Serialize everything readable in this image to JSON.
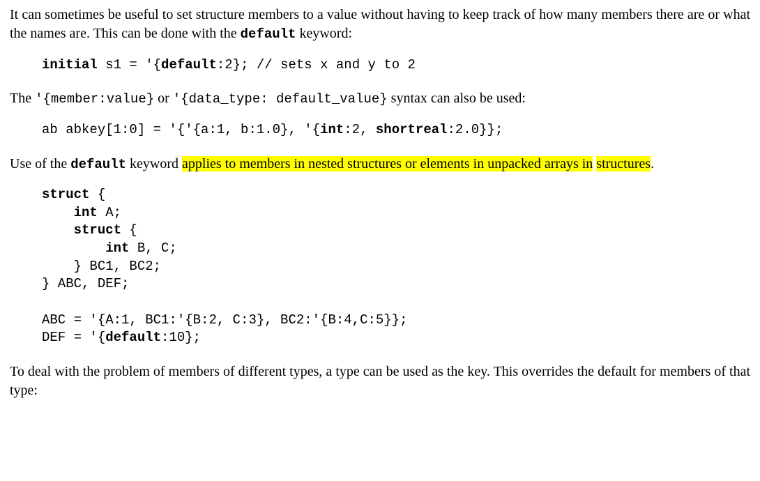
{
  "p1_a": "It can sometimes be useful to set structure members to a value without having to keep track of how many members there are or what the names are. This can be done with the ",
  "p1_kw": "default",
  "p1_b": " keyword:",
  "code1_a": "initial",
  "code1_b": " s1 = '{",
  "code1_c": "default",
  "code1_d": ":2}; // sets x and y to 2",
  "p2_a": "The ",
  "p2_m1": "'{member:value}",
  "p2_b": " or ",
  "p2_m2": "'{data_type: default_value}",
  "p2_c": " syntax can also be used:",
  "code2_a": "ab abkey[1:0] = '{'{a:1, b:1.0}, '{",
  "code2_b": "int",
  "code2_c": ":2, ",
  "code2_d": "shortreal",
  "code2_e": ":2.0}};",
  "p3_a": "Use of the ",
  "p3_kw": "default",
  "p3_b": " keyword ",
  "p3_hl1": "applies to members in nested structures or elements in unpacked arrays in",
  "p3_hl2": "structures",
  "p3_c": ".",
  "c3_l1a": "struct",
  "c3_l1b": " {",
  "c3_l2a": "    ",
  "c3_l2b": "int",
  "c3_l2c": " A;",
  "c3_l3a": "    ",
  "c3_l3b": "struct",
  "c3_l3c": " {",
  "c3_l4a": "        ",
  "c3_l4b": "int",
  "c3_l4c": " B, C;",
  "c3_l5": "    } BC1, BC2;",
  "c3_l6": "} ABC, DEF;",
  "c3_blank": " ",
  "c3_l8": "ABC = '{A:1, BC1:'{B:2, C:3}, BC2:'{B:4,C:5}};",
  "c3_l9a": "DEF = '{",
  "c3_l9b": "default",
  "c3_l9c": ":10};",
  "p4": "To deal with the problem of members of different types, a type can be used as the key. This overrides the default for members of that type:"
}
